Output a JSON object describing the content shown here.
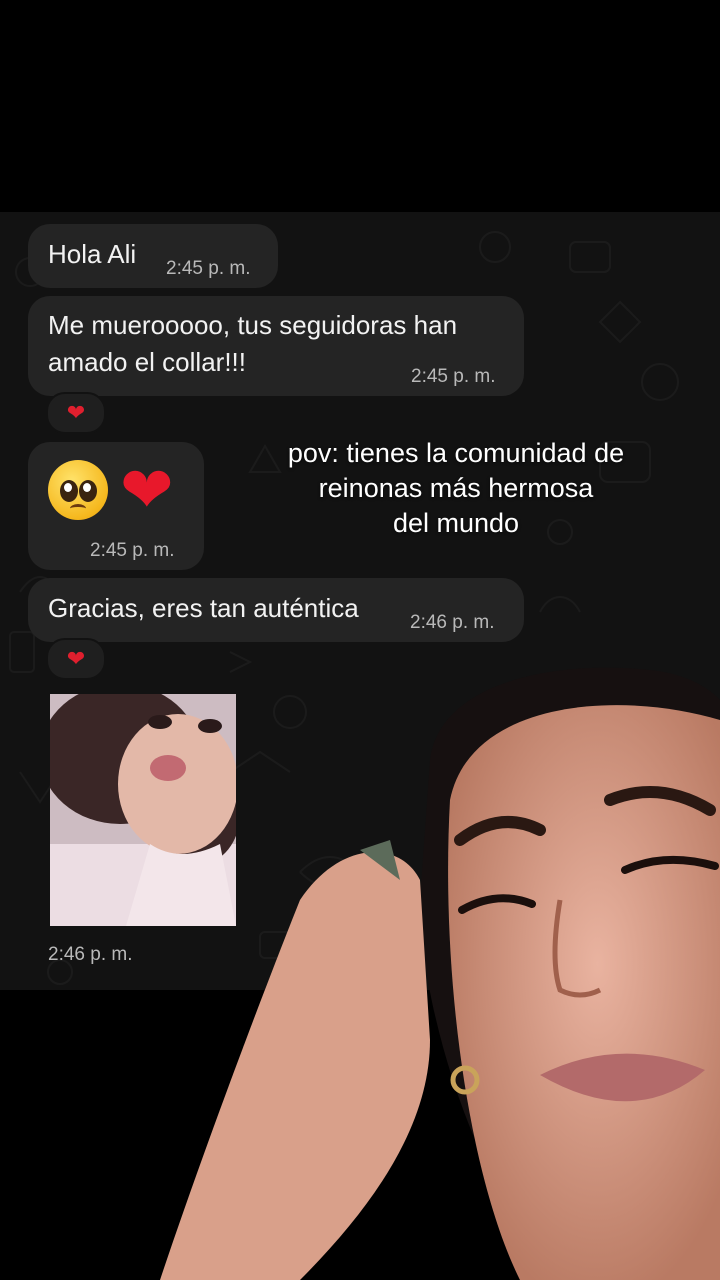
{
  "messages": [
    {
      "text": "Hola Ali",
      "time": "2:45 p. m."
    },
    {
      "text_line1": "Me muerooooo, tus seguidoras han",
      "text_line2": "amado el collar!!!",
      "time": "2:45 p. m.",
      "reaction": "❤"
    },
    {
      "emoji1": "pleading-face",
      "emoji2": "❤",
      "time": "2:45 p. m."
    },
    {
      "text": "Gracias, eres tan auténtica",
      "time": "2:46 p. m.",
      "reaction": "❤"
    },
    {
      "image": "photo of a young girl blowing a kiss",
      "time": "2:46 p. m."
    }
  ],
  "overlay": {
    "line1": "pov: tienes la comunidad de",
    "line2": "reinonas más hermosa",
    "line3": "del mundo"
  },
  "icons": {
    "reaction": "heart-icon",
    "emoji": [
      "pleading-face-icon",
      "heart-icon"
    ]
  },
  "colors": {
    "chat_bg": "#121212",
    "bubble": "#242424",
    "heart": "#e8182b"
  }
}
